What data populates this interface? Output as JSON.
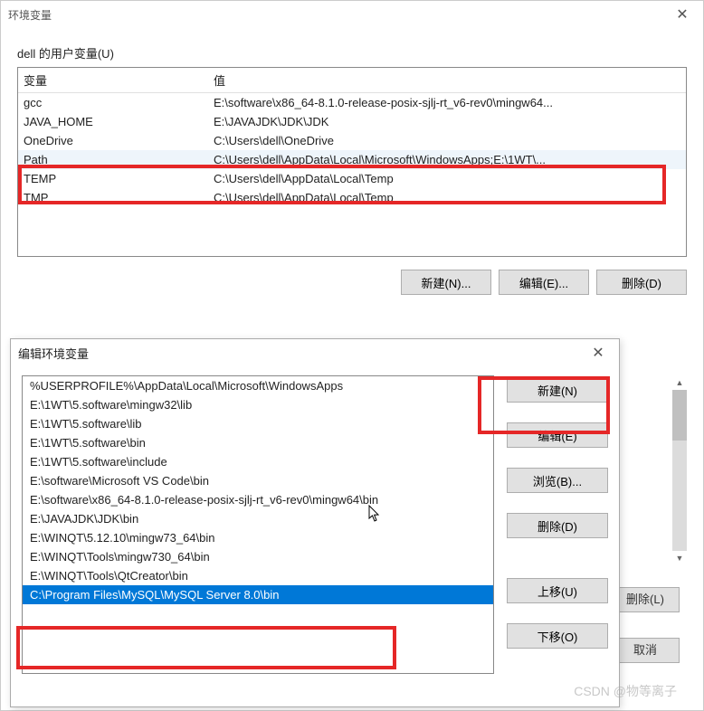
{
  "main": {
    "title": "环境变量",
    "user_vars_group_label": "dell 的用户变量(U)",
    "headers": {
      "col1": "变量",
      "col2": "值"
    },
    "rows": [
      {
        "name": "gcc",
        "value": "E:\\software\\x86_64-8.1.0-release-posix-sjlj-rt_v6-rev0\\mingw64..."
      },
      {
        "name": "JAVA_HOME",
        "value": "E:\\JAVAJDK\\JDK\\JDK"
      },
      {
        "name": "OneDrive",
        "value": "C:\\Users\\dell\\OneDrive"
      },
      {
        "name": "Path",
        "value": "C:\\Users\\dell\\AppData\\Local\\Microsoft\\WindowsApps;E:\\1WT\\..."
      },
      {
        "name": "TEMP",
        "value": "C:\\Users\\dell\\AppData\\Local\\Temp"
      },
      {
        "name": "TMP",
        "value": "C:\\Users\\dell\\AppData\\Local\\Temp"
      }
    ],
    "buttons": {
      "new": "新建(N)...",
      "edit": "编辑(E)...",
      "delete": "删除(D)"
    }
  },
  "edit": {
    "title": "编辑环境变量",
    "items": [
      "%USERPROFILE%\\AppData\\Local\\Microsoft\\WindowsApps",
      "E:\\1WT\\5.software\\mingw32\\lib",
      "E:\\1WT\\5.software\\lib",
      "E:\\1WT\\5.software\\bin",
      "E:\\1WT\\5.software\\include",
      "E:\\software\\Microsoft VS Code\\bin",
      "E:\\software\\x86_64-8.1.0-release-posix-sjlj-rt_v6-rev0\\mingw64\\bin",
      "E:\\JAVAJDK\\JDK\\bin",
      "E:\\WINQT\\5.12.10\\mingw73_64\\bin",
      "E:\\WINQT\\Tools\\mingw730_64\\bin",
      "E:\\WINQT\\Tools\\QtCreator\\bin",
      "C:\\Program Files\\MySQL\\MySQL Server 8.0\\bin"
    ],
    "buttons": {
      "new": "新建(N)",
      "edit": "编辑(E)",
      "browse": "浏览(B)...",
      "delete": "删除(D)",
      "up": "上移(U)",
      "down": "下移(O)"
    }
  },
  "under": {
    "delete": "删除(L)",
    "cancel": "取消"
  },
  "watermark": "CSDN @物等离子"
}
